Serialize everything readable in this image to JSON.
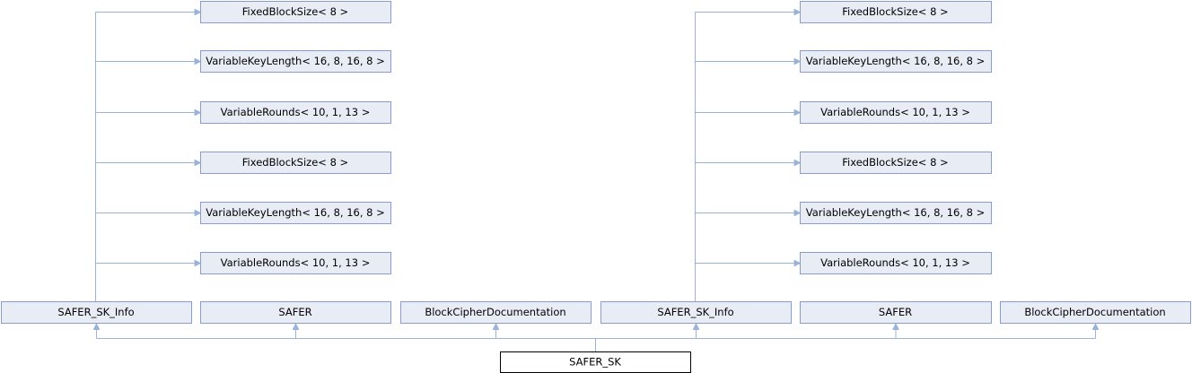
{
  "diagram": {
    "type": "class-inheritance-graph",
    "focus": {
      "id": "safer_sk",
      "label": "SAFER_SK"
    },
    "nodes": [
      {
        "id": "l_fixed1",
        "label": "FixedBlockSize< 8 >"
      },
      {
        "id": "l_varkey1",
        "label": "VariableKeyLength< 16, 8, 16, 8 >"
      },
      {
        "id": "l_varr1",
        "label": "VariableRounds< 10, 1, 13 >"
      },
      {
        "id": "l_fixed2",
        "label": "FixedBlockSize< 8 >"
      },
      {
        "id": "l_varkey2",
        "label": "VariableKeyLength< 16, 8, 16, 8 >"
      },
      {
        "id": "l_varr2",
        "label": "VariableRounds< 10, 1, 13 >"
      },
      {
        "id": "r_fixed1",
        "label": "FixedBlockSize< 8 >"
      },
      {
        "id": "r_varkey1",
        "label": "VariableKeyLength< 16, 8, 16, 8 >"
      },
      {
        "id": "r_varr1",
        "label": "VariableRounds< 10, 1, 13 >"
      },
      {
        "id": "r_fixed2",
        "label": "FixedBlockSize< 8 >"
      },
      {
        "id": "r_varkey2",
        "label": "VariableKeyLength< 16, 8, 16, 8 >"
      },
      {
        "id": "r_varr2",
        "label": "VariableRounds< 10, 1, 13 >"
      },
      {
        "id": "info1",
        "label": "SAFER_SK_Info"
      },
      {
        "id": "safer1",
        "label": "SAFER"
      },
      {
        "id": "bcd1",
        "label": "BlockCipherDocumentation"
      },
      {
        "id": "info2",
        "label": "SAFER_SK_Info"
      },
      {
        "id": "safer2",
        "label": "SAFER"
      },
      {
        "id": "bcd2",
        "label": "BlockCipherDocumentation"
      }
    ],
    "edges": [
      {
        "from": "safer_sk",
        "to": "info1"
      },
      {
        "from": "safer_sk",
        "to": "safer1"
      },
      {
        "from": "safer_sk",
        "to": "bcd1"
      },
      {
        "from": "safer_sk",
        "to": "info2"
      },
      {
        "from": "safer_sk",
        "to": "safer2"
      },
      {
        "from": "safer_sk",
        "to": "bcd2"
      },
      {
        "from": "info1",
        "to": "l_fixed1"
      },
      {
        "from": "info1",
        "to": "l_varkey1"
      },
      {
        "from": "info1",
        "to": "l_varr1"
      },
      {
        "from": "info1",
        "to": "l_fixed2"
      },
      {
        "from": "info1",
        "to": "l_varkey2"
      },
      {
        "from": "info1",
        "to": "l_varr2"
      },
      {
        "from": "info2",
        "to": "r_fixed1"
      },
      {
        "from": "info2",
        "to": "r_varkey1"
      },
      {
        "from": "info2",
        "to": "r_varr1"
      },
      {
        "from": "info2",
        "to": "r_fixed2"
      },
      {
        "from": "info2",
        "to": "r_varkey2"
      },
      {
        "from": "info2",
        "to": "r_varr2"
      }
    ],
    "colors": {
      "node_fill": "#e8ecf5",
      "node_border": "#8a9ccb",
      "edge": "#9bb3d9",
      "focus_border": "#000000"
    }
  }
}
